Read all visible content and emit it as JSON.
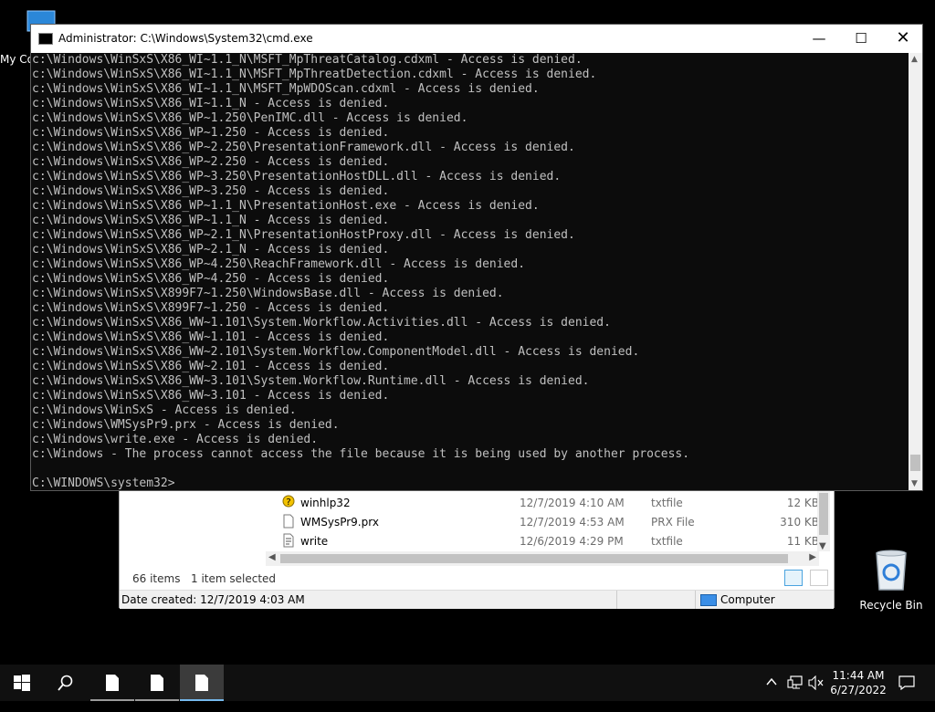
{
  "desktop": {
    "mycomputer_label": "My Co",
    "recycle_bin_label": "Recycle Bin"
  },
  "cmd": {
    "title": "Administrator: C:\\Windows\\System32\\cmd.exe",
    "minimize_glyph": "—",
    "maximize_glyph": "☐",
    "close_glyph": "✕",
    "lines": [
      "c:\\Windows\\WinSxS\\X86_WI~1.1_N\\MSFT_MpThreatCatalog.cdxml - Access is denied.",
      "c:\\Windows\\WinSxS\\X86_WI~1.1_N\\MSFT_MpThreatDetection.cdxml - Access is denied.",
      "c:\\Windows\\WinSxS\\X86_WI~1.1_N\\MSFT_MpWDOScan.cdxml - Access is denied.",
      "c:\\Windows\\WinSxS\\X86_WI~1.1_N - Access is denied.",
      "c:\\Windows\\WinSxS\\X86_WP~1.250\\PenIMC.dll - Access is denied.",
      "c:\\Windows\\WinSxS\\X86_WP~1.250 - Access is denied.",
      "c:\\Windows\\WinSxS\\X86_WP~2.250\\PresentationFramework.dll - Access is denied.",
      "c:\\Windows\\WinSxS\\X86_WP~2.250 - Access is denied.",
      "c:\\Windows\\WinSxS\\X86_WP~3.250\\PresentationHostDLL.dll - Access is denied.",
      "c:\\Windows\\WinSxS\\X86_WP~3.250 - Access is denied.",
      "c:\\Windows\\WinSxS\\X86_WP~1.1_N\\PresentationHost.exe - Access is denied.",
      "c:\\Windows\\WinSxS\\X86_WP~1.1_N - Access is denied.",
      "c:\\Windows\\WinSxS\\X86_WP~2.1_N\\PresentationHostProxy.dll - Access is denied.",
      "c:\\Windows\\WinSxS\\X86_WP~2.1_N - Access is denied.",
      "c:\\Windows\\WinSxS\\X86_WP~4.250\\ReachFramework.dll - Access is denied.",
      "c:\\Windows\\WinSxS\\X86_WP~4.250 - Access is denied.",
      "c:\\Windows\\WinSxS\\X899F7~1.250\\WindowsBase.dll - Access is denied.",
      "c:\\Windows\\WinSxS\\X899F7~1.250 - Access is denied.",
      "c:\\Windows\\WinSxS\\X86_WW~1.101\\System.Workflow.Activities.dll - Access is denied.",
      "c:\\Windows\\WinSxS\\X86_WW~1.101 - Access is denied.",
      "c:\\Windows\\WinSxS\\X86_WW~2.101\\System.Workflow.ComponentModel.dll - Access is denied.",
      "c:\\Windows\\WinSxS\\X86_WW~2.101 - Access is denied.",
      "c:\\Windows\\WinSxS\\X86_WW~3.101\\System.Workflow.Runtime.dll - Access is denied.",
      "c:\\Windows\\WinSxS\\X86_WW~3.101 - Access is denied.",
      "c:\\Windows\\WinSxS - Access is denied.",
      "c:\\Windows\\WMSysPr9.prx - Access is denied.",
      "c:\\Windows\\write.exe - Access is denied.",
      "c:\\Windows - The process cannot access the file because it is being used by another process.",
      "",
      "C:\\WINDOWS\\system32>"
    ]
  },
  "explorer": {
    "files": [
      {
        "name": "winhlp32",
        "date": "12/7/2019 4:10 AM",
        "type": "txtfile",
        "size": "12 KB",
        "icon": "help-file-icon"
      },
      {
        "name": "WMSysPr9.prx",
        "date": "12/7/2019 4:53 AM",
        "type": "PRX File",
        "size": "310 KB",
        "icon": "blank-file-icon"
      },
      {
        "name": "write",
        "date": "12/6/2019 4:29 PM",
        "type": "txtfile",
        "size": "11 KB",
        "icon": "wordpad-file-icon"
      }
    ],
    "status": {
      "items": "66 items",
      "selected": "1 item selected"
    },
    "details": {
      "created": "Date created: 12/7/2019 4:03 AM",
      "location": "Computer"
    }
  },
  "taskbar": {
    "time": "11:44 AM",
    "date": "6/27/2022"
  }
}
